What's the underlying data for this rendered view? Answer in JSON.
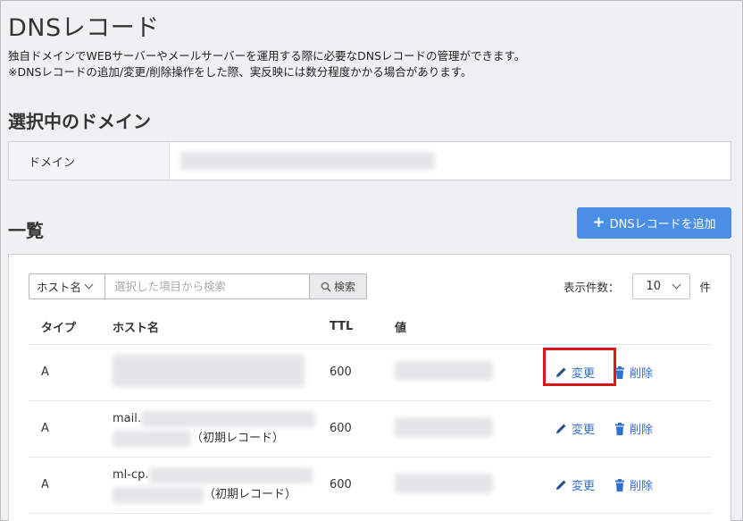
{
  "page": {
    "title": "DNSレコード",
    "description_line1": "独自ドメインでWEBサーバーやメールサーバーを運用する際に必要なDNSレコードの管理ができます。",
    "description_line2": "※DNSレコードの追加/変更/削除操作をした際、実反映には数分程度かかる場合があります。"
  },
  "selected_domain": {
    "section_title": "選択中のドメイン",
    "label": "ドメイン"
  },
  "list": {
    "section_title": "一覧",
    "add_button_label": "DNSレコードを追加",
    "search": {
      "filter_selected": "ホスト名",
      "placeholder": "選択した項目から検索",
      "button_label": "検索"
    },
    "display_count": {
      "label": "表示件数：",
      "value": "10",
      "unit": "件"
    },
    "columns": [
      "タイプ",
      "ホスト名",
      "TTL",
      "値"
    ],
    "rows": [
      {
        "type": "A",
        "host_prefix": "",
        "host_note": "",
        "ttl": "600",
        "edit_label": "変更",
        "delete_label": "削除"
      },
      {
        "type": "A",
        "host_prefix": "mail.",
        "host_note": "（初期レコード）",
        "ttl": "600",
        "edit_label": "変更",
        "delete_label": "削除"
      },
      {
        "type": "A",
        "host_prefix": "ml-cp.",
        "host_note": "（初期レコード）",
        "ttl": "600",
        "edit_label": "変更",
        "delete_label": "削除"
      }
    ]
  },
  "colors": {
    "accent": "#4a8ee8",
    "link": "#2f6fd0",
    "highlight": "#e0141b"
  }
}
